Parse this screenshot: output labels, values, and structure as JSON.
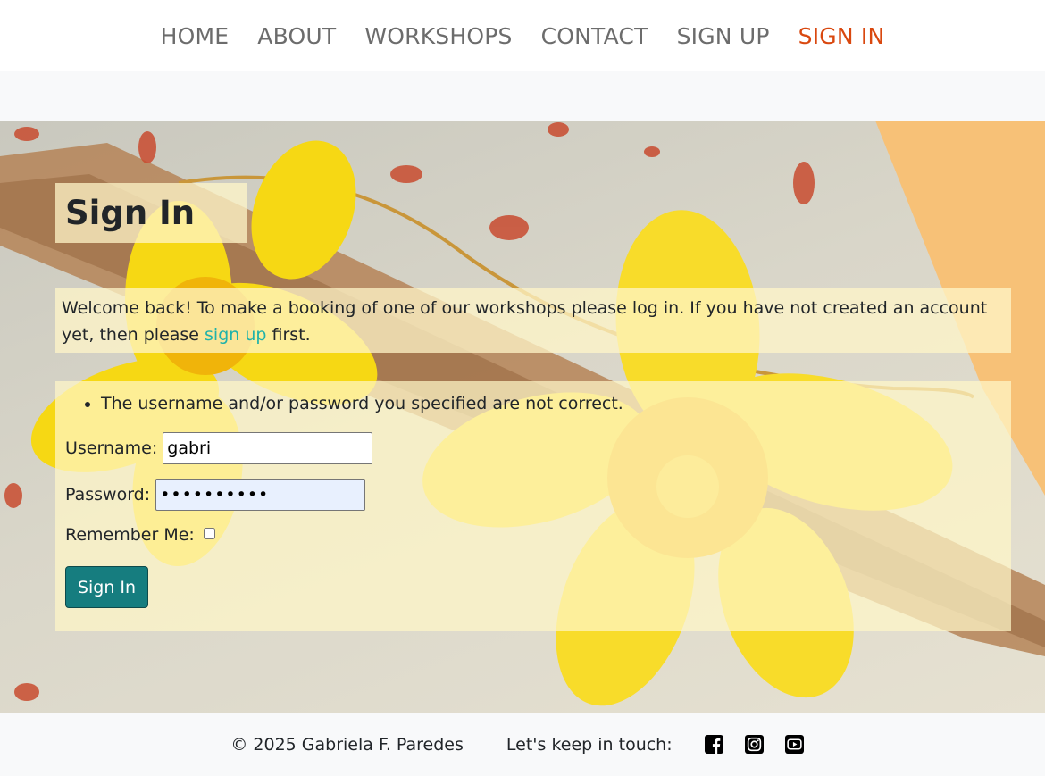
{
  "nav": {
    "items": [
      "HOME",
      "ABOUT",
      "WORKSHOPS",
      "CONTACT",
      "SIGN UP",
      "SIGN IN"
    ],
    "active": "SIGN IN",
    "active_color": "#d9480f"
  },
  "page": {
    "title": "Sign In",
    "welcome_before": "Welcome back! To make a booking of one of our workshops please log in. If you have not created an account yet, then please ",
    "welcome_link": "sign up",
    "welcome_after": " first."
  },
  "form": {
    "error": "The username and/or password you specified are not correct.",
    "username_label": "Username:",
    "username_value": "gabri",
    "password_label": "Password:",
    "password_value": "••••••••••",
    "remember_label": "Remember Me:",
    "remember_checked": false,
    "submit_label": "Sign In"
  },
  "footer": {
    "copyright": "© 2025 Gabriela F. Paredes",
    "keep_in_touch": "Let's keep in touch:",
    "social_icons": [
      "facebook-icon",
      "instagram-icon",
      "youtube-icon"
    ]
  },
  "colors": {
    "button": "#167d7f",
    "link": "#20b2aa",
    "panel": "rgba(255,246,200,0.75)"
  }
}
